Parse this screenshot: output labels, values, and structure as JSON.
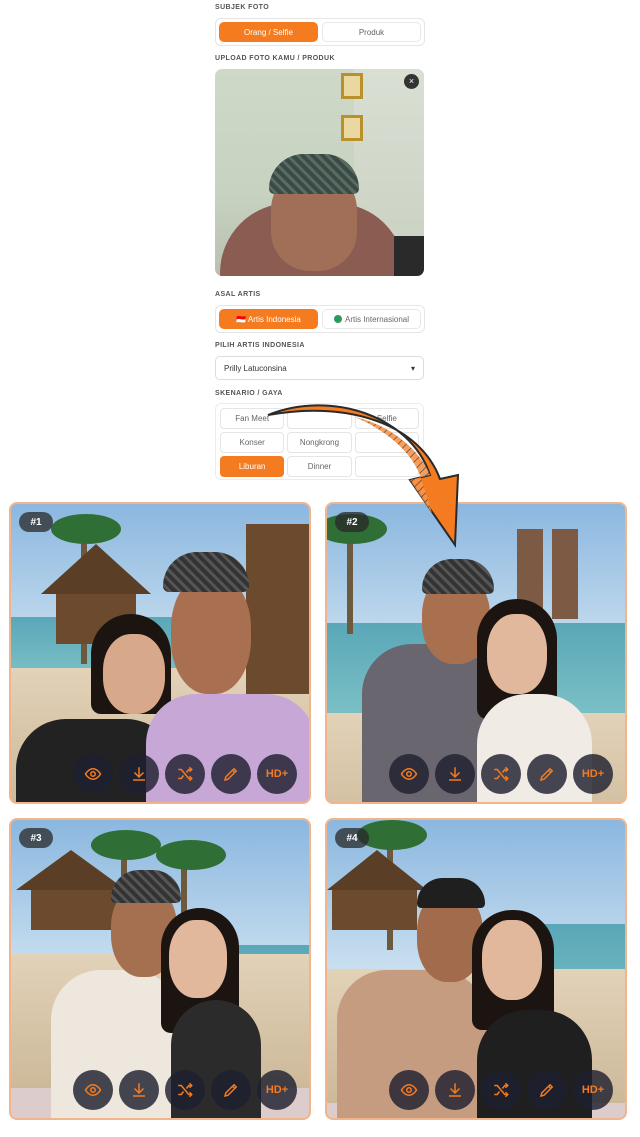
{
  "form": {
    "subject": {
      "label": "SUBJEK FOTO",
      "options": [
        "Orang / Selfie",
        "Produk"
      ],
      "selected": "Orang / Selfie"
    },
    "upload": {
      "label": "UPLOAD FOTO KAMU / PRODUK",
      "close_icon": "×"
    },
    "artist_origin": {
      "label": "ASAL ARTIS",
      "options": [
        "🇮🇩 Artis Indonesia",
        "Artis Internasional"
      ],
      "selected": "🇮🇩 Artis Indonesia"
    },
    "artist_select": {
      "label": "PILIH ARTIS INDONESIA",
      "value": "Prilly Latuconsina"
    },
    "scenario": {
      "label": "SKENARIO / GAYA",
      "options": [
        "Fan Meet",
        "",
        "Selfie",
        "Konser",
        "Nongkrong",
        "",
        "Liburan",
        "Dinner",
        ""
      ],
      "selected": "Liburan"
    }
  },
  "results": [
    {
      "badge": "#1",
      "hd_label": "HD+"
    },
    {
      "badge": "#2",
      "hd_label": "HD+"
    },
    {
      "badge": "#3",
      "hd_label": "HD+"
    },
    {
      "badge": "#4",
      "hd_label": "HD+"
    }
  ],
  "colors": {
    "accent": "#f47b20",
    "card_border": "#f2b48a",
    "action_bg": "#1e2030"
  },
  "icons": [
    "eye-icon",
    "download-icon",
    "shuffle-icon",
    "pencil-icon",
    "close-icon",
    "curved-arrow-icon"
  ]
}
